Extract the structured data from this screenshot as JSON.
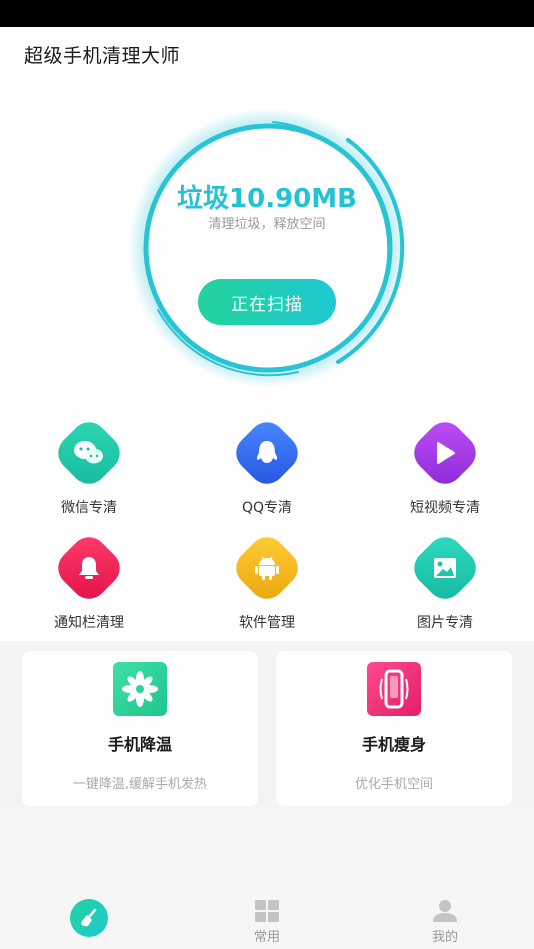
{
  "app": {
    "title": "超级手机清理大师"
  },
  "scan": {
    "junk_label": "垃圾10.90MB",
    "subtitle": "清理垃圾，释放空间",
    "button_label": "正在扫描"
  },
  "features": [
    {
      "label": "微信专清",
      "icon": "wechat-icon",
      "color": "#21c9a6"
    },
    {
      "label": "QQ专清",
      "icon": "qq-penguin-icon",
      "color": "#2f6ff0"
    },
    {
      "label": "短视频专清",
      "icon": "play-icon",
      "color": "#a13ce8"
    },
    {
      "label": "通知栏清理",
      "icon": "bell-icon",
      "color": "#f21f57"
    },
    {
      "label": "软件管理",
      "icon": "android-icon",
      "color": "#f2b41c"
    },
    {
      "label": "图片专清",
      "icon": "image-icon",
      "color": "#1ccfb0"
    }
  ],
  "cards": [
    {
      "title": "手机降温",
      "desc": "一键降温,缓解手机发热",
      "icon": "snowflake-icon",
      "color": "#2fd49a"
    },
    {
      "title": "手机瘦身",
      "desc": "优化手机空间",
      "icon": "phone-slim-icon",
      "color": "#f0307a"
    }
  ],
  "tabs": [
    {
      "label": "",
      "icon": "broom-icon",
      "active": true
    },
    {
      "label": "常用",
      "icon": "grid-icon",
      "active": false
    },
    {
      "label": "我的",
      "icon": "user-icon",
      "active": false
    }
  ],
  "colors": {
    "accent": "#25c2d6",
    "button_start": "#23d39c",
    "button_end": "#1ec9d2"
  }
}
